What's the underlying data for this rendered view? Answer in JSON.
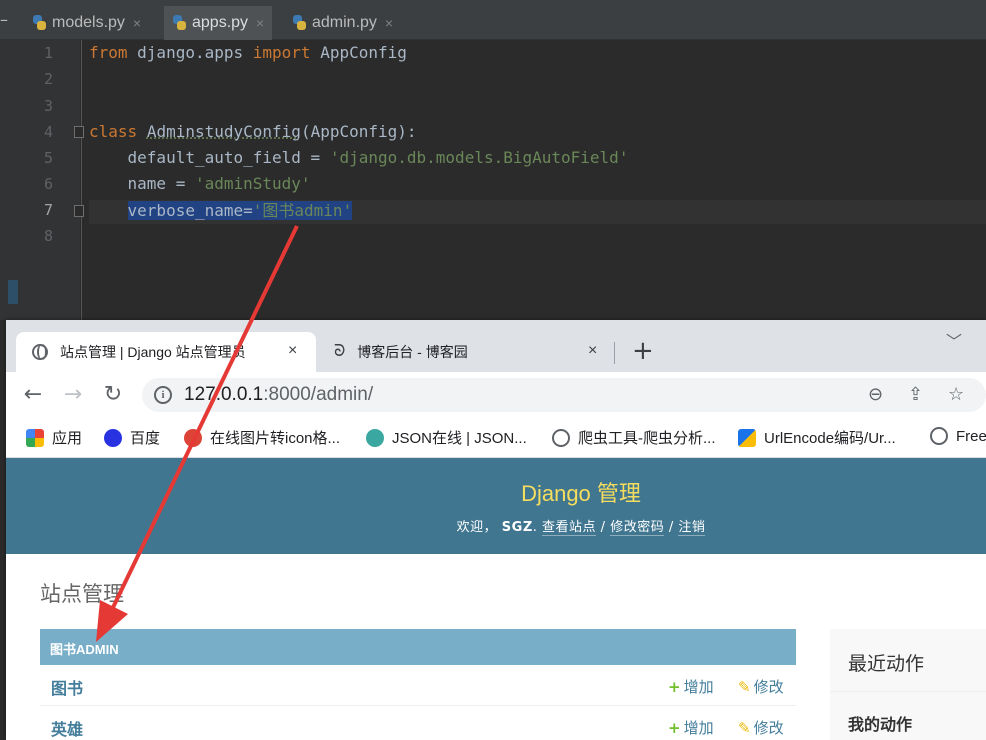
{
  "ide": {
    "tabs": [
      {
        "label": "models.py",
        "close": "×"
      },
      {
        "label": "apps.py",
        "close": "×"
      },
      {
        "label": "admin.py",
        "close": "×"
      }
    ],
    "minimize": "–",
    "line_numbers": [
      "1",
      "2",
      "3",
      "4",
      "5",
      "6",
      "7",
      "8"
    ],
    "code": {
      "l1_kw1": "from",
      "l1_mid": " django.apps ",
      "l1_kw2": "import",
      "l1_end": " AppConfig",
      "l4_kw": "class",
      "l4_name": "AdminstudyConfig",
      "l4_end": "(AppConfig):",
      "l5_a": "    default_auto_field = ",
      "l5_str": "'django.db.models.BigAutoField'",
      "l6_a": "    name = ",
      "l6_str": "'adminStudy'",
      "l7_indent": "    ",
      "l7_a": "verbose_name=",
      "l7_str": "'图书admin'"
    }
  },
  "browser": {
    "tabs": [
      {
        "title": "站点管理 | Django 站点管理员",
        "close": "×"
      },
      {
        "title": "博客后台 - 博客园",
        "close": "×"
      }
    ],
    "new_tab": "+",
    "tab_menu": "﹀",
    "nav": {
      "back": "←",
      "forward": "→",
      "reload": "↻"
    },
    "address": {
      "host": "127.0.0.1",
      "rest": ":8000/admin/",
      "info": "i"
    },
    "omnibox_icons": {
      "zoom": "⊖",
      "share": "⇪",
      "bookmark": "☆"
    },
    "bookmarks": [
      {
        "label": "应用",
        "color": "#ea4335"
      },
      {
        "label": "百度",
        "color": "#2932e1"
      },
      {
        "label": "在线图片转icon格...",
        "color": "#db4437"
      },
      {
        "label": "JSON在线 | JSON...",
        "color": "#3aa8a0"
      },
      {
        "label": "爬虫工具-爬虫分析...",
        "color": "#5f6368"
      },
      {
        "label": "UrlEncode编码/Ur...",
        "color": "#1a73e8"
      },
      {
        "label": "Free",
        "color": "#5f6368"
      }
    ]
  },
  "django": {
    "brand": "Django 管理",
    "welcome": "欢迎，",
    "user": "SGZ",
    "sep_dot": ". ",
    "view_site": "查看站点",
    "slash1": " / ",
    "change_password": "修改密码",
    "slash2": " / ",
    "logout": "注销",
    "page_title": "站点管理",
    "module_caption": "图书ADMIN",
    "models": [
      {
        "name": "图书",
        "add": "增加",
        "change": "修改"
      },
      {
        "name": "英雄",
        "add": "增加",
        "change": "修改"
      }
    ],
    "add_icon": "+",
    "change_icon": "✎",
    "recent_actions": "最近动作",
    "my_actions": "我的动作",
    "colors": {
      "header": "#417690",
      "brand": "#f5dd5d",
      "caption": "#79aec8",
      "link": "#447e9b",
      "arrow": "#e53935"
    }
  }
}
